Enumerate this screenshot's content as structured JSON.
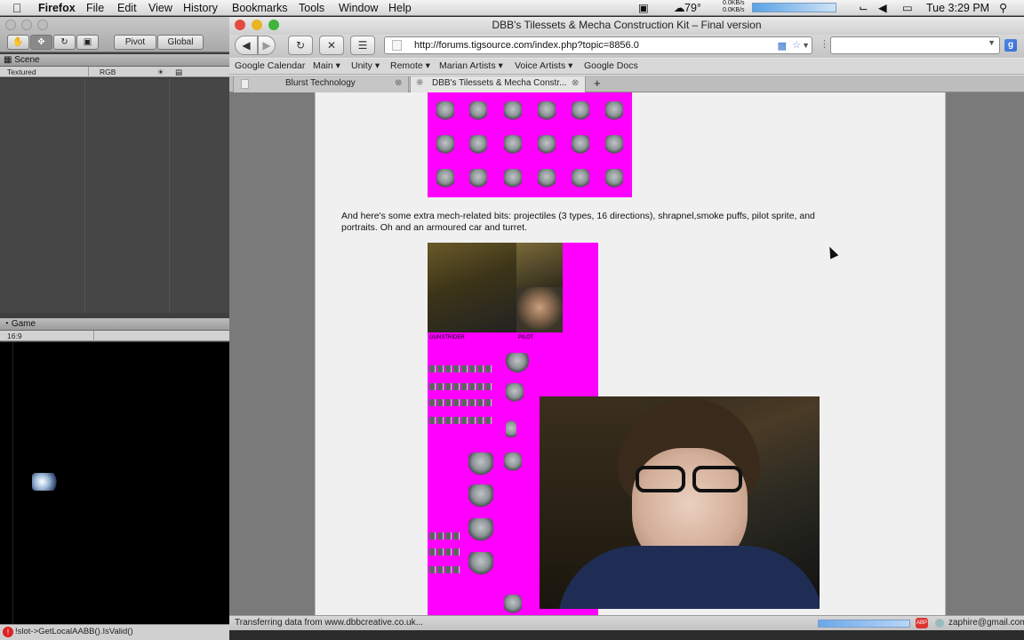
{
  "menubar": {
    "app_name": "Firefox",
    "items": [
      "File",
      "Edit",
      "View",
      "History",
      "Bookmarks",
      "Tools",
      "Window",
      "Help"
    ],
    "temperature": "79°",
    "net_up": "0.0KB/s",
    "net_down": "0.0KB/s",
    "clock": "Tue 3:29 PM"
  },
  "unity": {
    "pivot_label": "Pivot",
    "global_label": "Global",
    "scene_tab": "Scene",
    "scene_render_mode": "Textured",
    "scene_channel": "RGB",
    "game_tab": "Game",
    "game_aspect": "16:9",
    "console_error": "!slot->GetLocalAABB().IsValid()"
  },
  "firefox": {
    "window_title": "DBB's Tilessets & Mecha Construction Kit – Final version",
    "url": "http://forums.tigsource.com/index.php?topic=8856.0",
    "bookmarks": [
      "Google Calendar",
      "Main",
      "Unity",
      "Remote",
      "Marian Artists",
      "Voice Artists",
      "Google Docs"
    ],
    "tabs": [
      "Blurst Technology",
      "DBB's Tilessets & Mecha Constr..."
    ],
    "status_text": "Transferring data from www.dbbcreative.co.uk...",
    "status_user": "zaphire@gmail.com"
  },
  "page": {
    "body_text": "And here's some extra mech-related bits: projectiles (3 types, 16 directions), shrapnel,smoke puffs, pilot sprite, and portraits. Oh and an armoured car and turret.",
    "portrait_label_1": "GUNSTRIDER",
    "portrait_label_2": "PILOT"
  },
  "colors": {
    "sprite_sheet_bg": "#ff00ff",
    "page_bg": "#f0f0f0"
  }
}
